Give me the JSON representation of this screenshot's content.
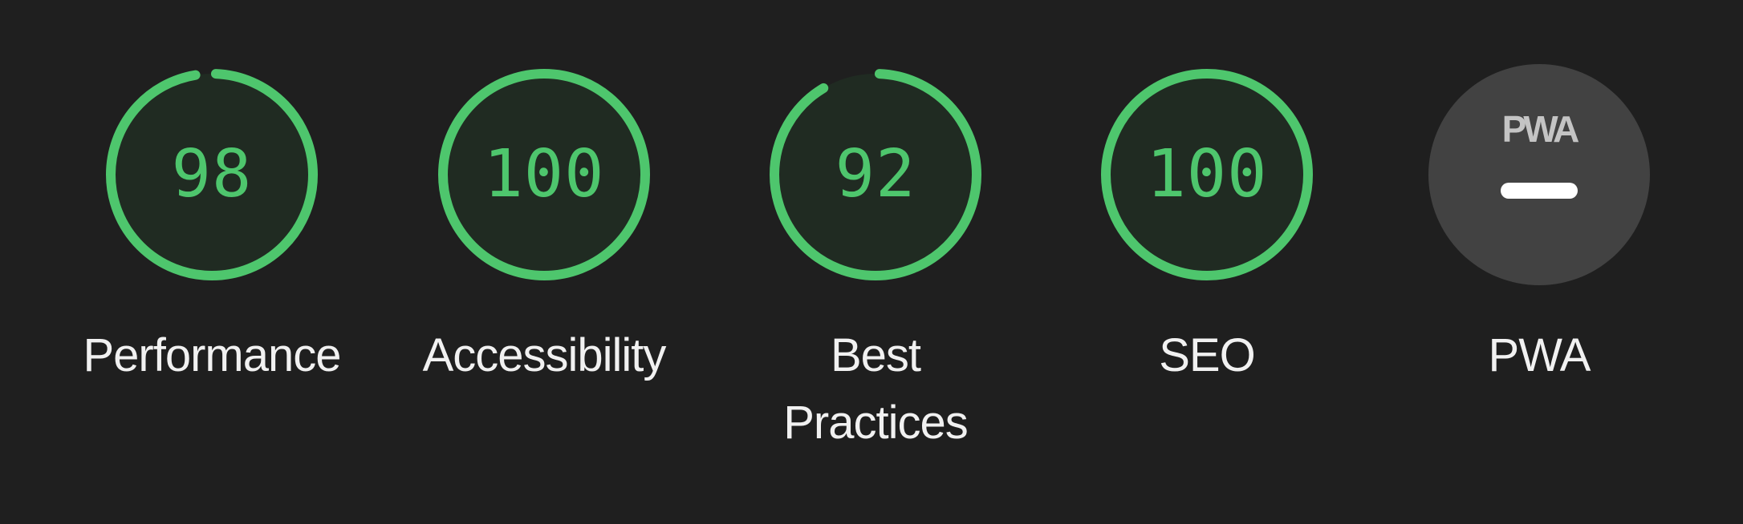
{
  "colors": {
    "background": "#1f1f1f",
    "pass": "#4ec66d",
    "pass_fill": "#202b22",
    "label": "#f1f1f1",
    "pwa_badge": "#424242",
    "pwa_logo": "#c4c4c4",
    "pwa_dash": "#ffffff"
  },
  "gauges": [
    {
      "label": "Performance",
      "score": "98",
      "fraction": 0.98
    },
    {
      "label": "Accessibility",
      "score": "100",
      "fraction": 1.0
    },
    {
      "label": "Best\nPractices",
      "score": "92",
      "fraction": 0.92
    },
    {
      "label": "SEO",
      "score": "100",
      "fraction": 1.0
    }
  ],
  "pwa": {
    "label": "PWA",
    "logo_text": "PWA",
    "icon": "dash-icon"
  }
}
